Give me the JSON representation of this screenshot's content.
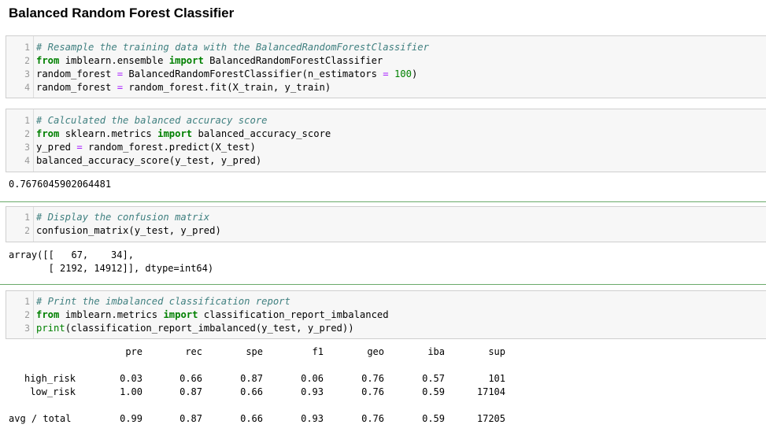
{
  "title": "Balanced Random Forest Classifier",
  "cells": [
    {
      "lines": [
        {
          "n": "1",
          "parts": [
            {
              "t": "# Resample the training data with the BalancedRandomForestClassifier",
              "c": "cm"
            }
          ]
        },
        {
          "n": "2",
          "parts": [
            {
              "t": "from",
              "c": "kw"
            },
            {
              "t": " imblearn.ensemble ",
              "c": ""
            },
            {
              "t": "import",
              "c": "kw"
            },
            {
              "t": " BalancedRandomForestClassifier",
              "c": ""
            }
          ]
        },
        {
          "n": "3",
          "parts": [
            {
              "t": "random_forest ",
              "c": ""
            },
            {
              "t": "=",
              "c": "op"
            },
            {
              "t": " BalancedRandomForestClassifier(n_estimators ",
              "c": ""
            },
            {
              "t": "=",
              "c": "op"
            },
            {
              "t": " ",
              "c": ""
            },
            {
              "t": "100",
              "c": "nu"
            },
            {
              "t": ")",
              "c": ""
            }
          ]
        },
        {
          "n": "4",
          "parts": [
            {
              "t": "random_forest ",
              "c": ""
            },
            {
              "t": "=",
              "c": "op"
            },
            {
              "t": " random_forest.fit(X_train, y_train)",
              "c": ""
            }
          ]
        }
      ]
    },
    {
      "lines": [
        {
          "n": "1",
          "parts": [
            {
              "t": "# Calculated the balanced accuracy score",
              "c": "cm"
            }
          ]
        },
        {
          "n": "2",
          "parts": [
            {
              "t": "from",
              "c": "kw"
            },
            {
              "t": " sklearn.metrics ",
              "c": ""
            },
            {
              "t": "import",
              "c": "kw"
            },
            {
              "t": " balanced_accuracy_score",
              "c": ""
            }
          ]
        },
        {
          "n": "3",
          "parts": [
            {
              "t": "y_pred ",
              "c": ""
            },
            {
              "t": "=",
              "c": "op"
            },
            {
              "t": " random_forest.predict(X_test)",
              "c": ""
            }
          ]
        },
        {
          "n": "4",
          "parts": [
            {
              "t": "balanced_accuracy_score(y_test, y_pred)",
              "c": ""
            }
          ]
        }
      ]
    },
    {
      "lines": [
        {
          "n": "1",
          "parts": [
            {
              "t": "# Display the confusion matrix",
              "c": "cm"
            }
          ]
        },
        {
          "n": "2",
          "parts": [
            {
              "t": "confusion_matrix(y_test, y_pred)",
              "c": ""
            }
          ]
        }
      ]
    },
    {
      "lines": [
        {
          "n": "1",
          "parts": [
            {
              "t": "# Print the imbalanced classification report",
              "c": "cm"
            }
          ]
        },
        {
          "n": "2",
          "parts": [
            {
              "t": "from",
              "c": "kw"
            },
            {
              "t": " imblearn.metrics ",
              "c": ""
            },
            {
              "t": "import",
              "c": "kw"
            },
            {
              "t": " classification_report_imbalanced",
              "c": ""
            }
          ]
        },
        {
          "n": "3",
          "parts": [
            {
              "t": "print",
              "c": "bi"
            },
            {
              "t": "(classification_report_imbalanced(y_test, y_pred))",
              "c": ""
            }
          ]
        }
      ]
    }
  ],
  "outputs": {
    "accuracy": "0.7676045902064481",
    "matrix_line1": "array([[   67,    34],",
    "matrix_line2": "       [ 2192, 14912]], dtype=int64)"
  },
  "report": {
    "headers": [
      "pre",
      "rec",
      "spe",
      "f1",
      "geo",
      "iba",
      "sup"
    ],
    "rows": [
      {
        "label": "high_risk",
        "values": [
          "0.03",
          "0.66",
          "0.87",
          "0.06",
          "0.76",
          "0.57",
          "101"
        ]
      },
      {
        "label": "low_risk",
        "values": [
          "1.00",
          "0.87",
          "0.66",
          "0.93",
          "0.76",
          "0.59",
          "17104"
        ]
      },
      {
        "label": "avg / total",
        "values": [
          "0.99",
          "0.87",
          "0.66",
          "0.93",
          "0.76",
          "0.59",
          "17205"
        ]
      }
    ]
  }
}
